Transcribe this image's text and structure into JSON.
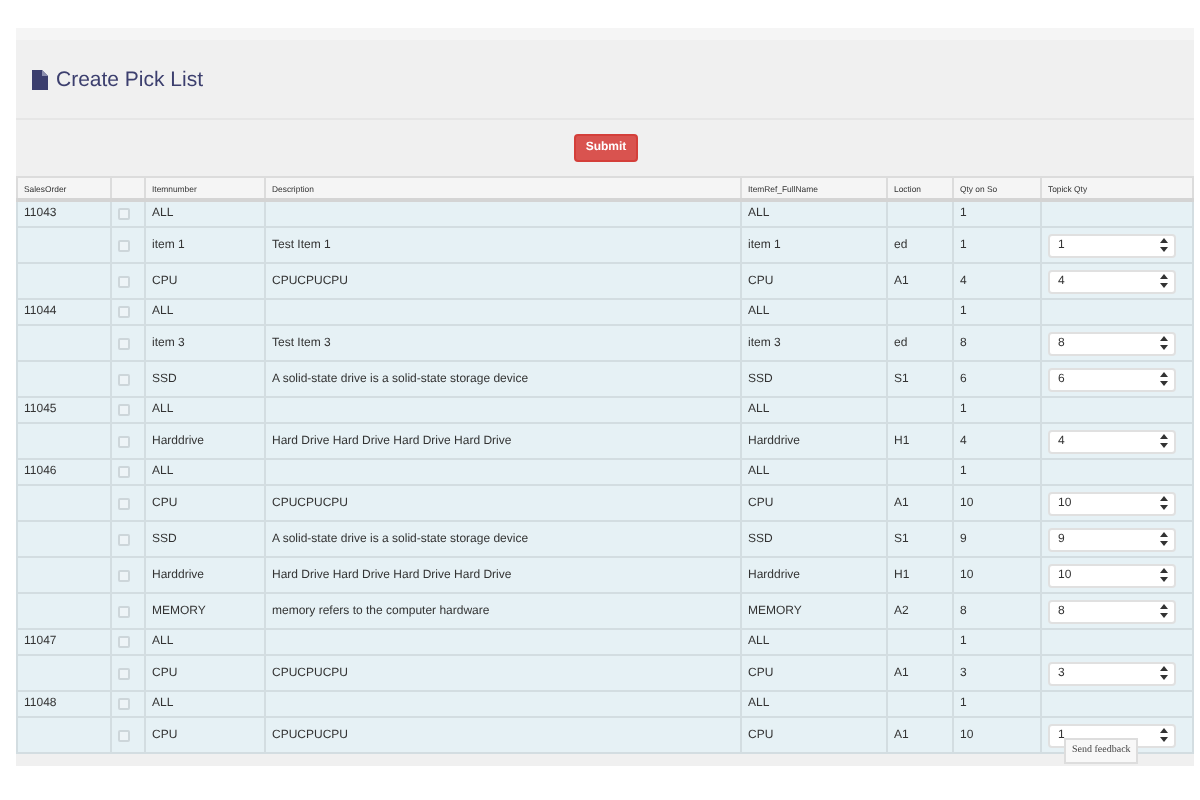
{
  "page": {
    "title": "Create Pick List"
  },
  "submit_button": "Submit",
  "table": {
    "columns": [
      "SalesOrder",
      "",
      "Itemnumber",
      "Description",
      "ItemRef_FullName",
      "Loction",
      "Qty on So",
      "Topick Qty"
    ],
    "rows": [
      {
        "sales_order": "11043",
        "checked": false,
        "item_number": "ALL",
        "item_ref": "ALL",
        "qty_on_so": "1"
      },
      {
        "checked": false,
        "item_number": "item 1",
        "description": "Test Item 1",
        "item_ref": "item 1",
        "location": "ed",
        "qty_on_so": "1",
        "topick_qty": "1"
      },
      {
        "checked": false,
        "item_number": "CPU",
        "description": "CPUCPUCPU",
        "item_ref": "CPU",
        "location": "A1",
        "qty_on_so": "4",
        "topick_qty": "4"
      },
      {
        "sales_order": "11044",
        "checked": false,
        "item_number": "ALL",
        "item_ref": "ALL",
        "qty_on_so": "1"
      },
      {
        "checked": false,
        "item_number": "item 3",
        "description": "Test Item 3",
        "item_ref": "item 3",
        "location": "ed",
        "qty_on_so": "8",
        "topick_qty": "8"
      },
      {
        "checked": false,
        "item_number": "SSD",
        "description": "A solid-state drive is a solid-state storage device",
        "item_ref": "SSD",
        "location": "S1",
        "qty_on_so": "6",
        "topick_qty": "6"
      },
      {
        "sales_order": "11045",
        "checked": false,
        "item_number": "ALL",
        "item_ref": "ALL",
        "qty_on_so": "1"
      },
      {
        "checked": false,
        "item_number": "Harddrive",
        "description": "Hard Drive Hard Drive Hard Drive Hard Drive",
        "item_ref": "Harddrive",
        "location": "H1",
        "qty_on_so": "4",
        "topick_qty": "4"
      },
      {
        "sales_order": "11046",
        "checked": false,
        "item_number": "ALL",
        "item_ref": "ALL",
        "qty_on_so": "1"
      },
      {
        "checked": false,
        "item_number": "CPU",
        "description": "CPUCPUCPU",
        "item_ref": "CPU",
        "location": "A1",
        "qty_on_so": "10",
        "topick_qty": "10"
      },
      {
        "checked": false,
        "item_number": "SSD",
        "description": "A solid-state drive is a solid-state storage device",
        "item_ref": "SSD",
        "location": "S1",
        "qty_on_so": "9",
        "topick_qty": "9"
      },
      {
        "checked": false,
        "item_number": "Harddrive",
        "description": "Hard Drive Hard Drive Hard Drive Hard Drive",
        "item_ref": "Harddrive",
        "location": "H1",
        "qty_on_so": "10",
        "topick_qty": "10"
      },
      {
        "checked": false,
        "item_number": "MEMORY",
        "description": "memory refers to the computer hardware",
        "item_ref": "MEMORY",
        "location": "A2",
        "qty_on_so": "8",
        "topick_qty": "8"
      },
      {
        "sales_order": "11047",
        "checked": false,
        "item_number": "ALL",
        "item_ref": "ALL",
        "qty_on_so": "1"
      },
      {
        "checked": false,
        "item_number": "CPU",
        "description": "CPUCPUCPU",
        "item_ref": "CPU",
        "location": "A1",
        "qty_on_so": "3",
        "topick_qty": "3"
      },
      {
        "sales_order": "11048",
        "checked": false,
        "item_number": "ALL",
        "item_ref": "ALL",
        "qty_on_so": "1"
      },
      {
        "checked": false,
        "item_number": "CPU",
        "description": "CPUCPUCPU",
        "item_ref": "CPU",
        "location": "A1",
        "qty_on_so": "10",
        "topick_qty": "1"
      }
    ]
  },
  "feedback_button": "Send feedback"
}
